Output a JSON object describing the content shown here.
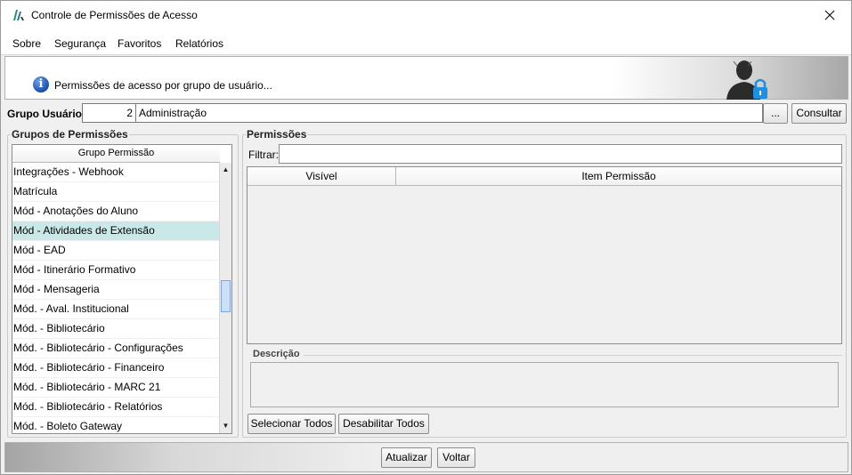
{
  "window": {
    "title": "Controle de Permissões de Acesso",
    "close_symbol": "✕"
  },
  "menu": [
    {
      "label": "Sobre"
    },
    {
      "label": "Segurança"
    },
    {
      "label": "Favoritos"
    },
    {
      "label": "Relatórios"
    }
  ],
  "banner": {
    "text": "Permissões de acesso por grupo de usuário...",
    "icon": "info-icon",
    "right_icon": "user-lock-icon"
  },
  "grupo": {
    "label": "Grupo Usuário:",
    "id_value": "2",
    "name_value": "Administração",
    "browse_label": "...",
    "consult_label": "Consultar"
  },
  "grupos_permissoes": {
    "title": "Grupos de Permissões",
    "column": "Grupo Permissão",
    "items": [
      "Integrações - Webhook",
      "Matrícula",
      "Mód - Anotações do Aluno",
      "Mód - Atividades de Extensão",
      "Mód - EAD",
      "Mód - Itinerário Formativo",
      "Mód - Mensageria",
      "Mód. - Aval. Institucional",
      "Mód. - Bibliotecário",
      "Mód. - Bibliotecário - Configurações",
      "Mód. - Bibliotecário - Financeiro",
      "Mód. - Bibliotecário - MARC 21",
      "Mód. - Bibliotecário - Relatórios",
      "Mód. - Boleto Gateway"
    ],
    "selected": "Mód - Atividades de Extensão"
  },
  "permissoes": {
    "title": "Permissões",
    "filter_label": "Filtrar:",
    "filter_value": "",
    "columns": [
      "Visível",
      "Item Permissão"
    ],
    "description_label": "Descrição",
    "select_all_label": "Selecionar Todos",
    "disable_all_label": "Desabilitar Todos"
  },
  "footer": {
    "update_label": "Atualizar",
    "back_label": "Voltar"
  },
  "colors": {
    "selection": "#c9e8e7",
    "accent_blue": "#1a4fae",
    "lock_blue": "#1f8fe0"
  }
}
